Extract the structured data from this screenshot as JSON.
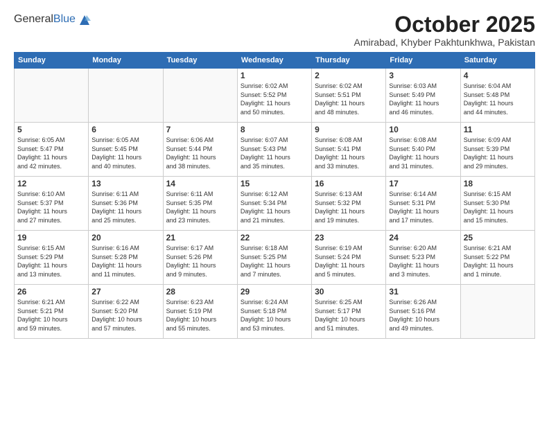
{
  "header": {
    "logo_general": "General",
    "logo_blue": "Blue",
    "month": "October 2025",
    "location": "Amirabad, Khyber Pakhtunkhwa, Pakistan"
  },
  "weekdays": [
    "Sunday",
    "Monday",
    "Tuesday",
    "Wednesday",
    "Thursday",
    "Friday",
    "Saturday"
  ],
  "weeks": [
    [
      {
        "day": "",
        "info": ""
      },
      {
        "day": "",
        "info": ""
      },
      {
        "day": "",
        "info": ""
      },
      {
        "day": "1",
        "info": "Sunrise: 6:02 AM\nSunset: 5:52 PM\nDaylight: 11 hours\nand 50 minutes."
      },
      {
        "day": "2",
        "info": "Sunrise: 6:02 AM\nSunset: 5:51 PM\nDaylight: 11 hours\nand 48 minutes."
      },
      {
        "day": "3",
        "info": "Sunrise: 6:03 AM\nSunset: 5:49 PM\nDaylight: 11 hours\nand 46 minutes."
      },
      {
        "day": "4",
        "info": "Sunrise: 6:04 AM\nSunset: 5:48 PM\nDaylight: 11 hours\nand 44 minutes."
      }
    ],
    [
      {
        "day": "5",
        "info": "Sunrise: 6:05 AM\nSunset: 5:47 PM\nDaylight: 11 hours\nand 42 minutes."
      },
      {
        "day": "6",
        "info": "Sunrise: 6:05 AM\nSunset: 5:45 PM\nDaylight: 11 hours\nand 40 minutes."
      },
      {
        "day": "7",
        "info": "Sunrise: 6:06 AM\nSunset: 5:44 PM\nDaylight: 11 hours\nand 38 minutes."
      },
      {
        "day": "8",
        "info": "Sunrise: 6:07 AM\nSunset: 5:43 PM\nDaylight: 11 hours\nand 35 minutes."
      },
      {
        "day": "9",
        "info": "Sunrise: 6:08 AM\nSunset: 5:41 PM\nDaylight: 11 hours\nand 33 minutes."
      },
      {
        "day": "10",
        "info": "Sunrise: 6:08 AM\nSunset: 5:40 PM\nDaylight: 11 hours\nand 31 minutes."
      },
      {
        "day": "11",
        "info": "Sunrise: 6:09 AM\nSunset: 5:39 PM\nDaylight: 11 hours\nand 29 minutes."
      }
    ],
    [
      {
        "day": "12",
        "info": "Sunrise: 6:10 AM\nSunset: 5:37 PM\nDaylight: 11 hours\nand 27 minutes."
      },
      {
        "day": "13",
        "info": "Sunrise: 6:11 AM\nSunset: 5:36 PM\nDaylight: 11 hours\nand 25 minutes."
      },
      {
        "day": "14",
        "info": "Sunrise: 6:11 AM\nSunset: 5:35 PM\nDaylight: 11 hours\nand 23 minutes."
      },
      {
        "day": "15",
        "info": "Sunrise: 6:12 AM\nSunset: 5:34 PM\nDaylight: 11 hours\nand 21 minutes."
      },
      {
        "day": "16",
        "info": "Sunrise: 6:13 AM\nSunset: 5:32 PM\nDaylight: 11 hours\nand 19 minutes."
      },
      {
        "day": "17",
        "info": "Sunrise: 6:14 AM\nSunset: 5:31 PM\nDaylight: 11 hours\nand 17 minutes."
      },
      {
        "day": "18",
        "info": "Sunrise: 6:15 AM\nSunset: 5:30 PM\nDaylight: 11 hours\nand 15 minutes."
      }
    ],
    [
      {
        "day": "19",
        "info": "Sunrise: 6:15 AM\nSunset: 5:29 PM\nDaylight: 11 hours\nand 13 minutes."
      },
      {
        "day": "20",
        "info": "Sunrise: 6:16 AM\nSunset: 5:28 PM\nDaylight: 11 hours\nand 11 minutes."
      },
      {
        "day": "21",
        "info": "Sunrise: 6:17 AM\nSunset: 5:26 PM\nDaylight: 11 hours\nand 9 minutes."
      },
      {
        "day": "22",
        "info": "Sunrise: 6:18 AM\nSunset: 5:25 PM\nDaylight: 11 hours\nand 7 minutes."
      },
      {
        "day": "23",
        "info": "Sunrise: 6:19 AM\nSunset: 5:24 PM\nDaylight: 11 hours\nand 5 minutes."
      },
      {
        "day": "24",
        "info": "Sunrise: 6:20 AM\nSunset: 5:23 PM\nDaylight: 11 hours\nand 3 minutes."
      },
      {
        "day": "25",
        "info": "Sunrise: 6:21 AM\nSunset: 5:22 PM\nDaylight: 11 hours\nand 1 minute."
      }
    ],
    [
      {
        "day": "26",
        "info": "Sunrise: 6:21 AM\nSunset: 5:21 PM\nDaylight: 10 hours\nand 59 minutes."
      },
      {
        "day": "27",
        "info": "Sunrise: 6:22 AM\nSunset: 5:20 PM\nDaylight: 10 hours\nand 57 minutes."
      },
      {
        "day": "28",
        "info": "Sunrise: 6:23 AM\nSunset: 5:19 PM\nDaylight: 10 hours\nand 55 minutes."
      },
      {
        "day": "29",
        "info": "Sunrise: 6:24 AM\nSunset: 5:18 PM\nDaylight: 10 hours\nand 53 minutes."
      },
      {
        "day": "30",
        "info": "Sunrise: 6:25 AM\nSunset: 5:17 PM\nDaylight: 10 hours\nand 51 minutes."
      },
      {
        "day": "31",
        "info": "Sunrise: 6:26 AM\nSunset: 5:16 PM\nDaylight: 10 hours\nand 49 minutes."
      },
      {
        "day": "",
        "info": ""
      }
    ]
  ]
}
